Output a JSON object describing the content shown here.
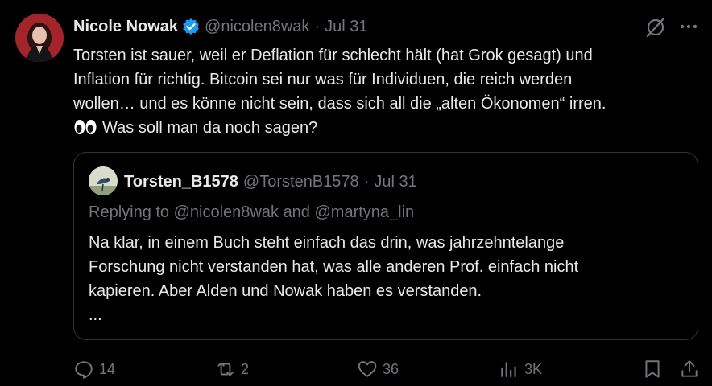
{
  "tweet": {
    "author_name": "Nicole Nowak",
    "handle": "@nicolen8wak",
    "separator": "·",
    "date": "Jul 31",
    "lines": [
      "Torsten ist sauer, weil er Deflation für schlecht hält (hat Grok gesagt) und",
      "Inflation für richtig. Bitcoin sei nur was für Individuen, die reich werden",
      "wollen… und es könne nicht sein, dass sich all die „alten Ökonomen“ irren.",
      "Was soll man da noch sagen?"
    ]
  },
  "quote": {
    "author_name": "Torsten_B1578",
    "handle": "@TorstenB1578",
    "separator": "·",
    "date": "Jul 31",
    "replying_prefix": "Replying to",
    "mention_1": "@nicolen8wak",
    "replying_and": "and",
    "mention_2": "@martyna_lin",
    "lines": [
      "Na klar, in einem Buch steht einfach das drin, was jahrzehntelange",
      "Forschung nicht verstanden hat, was alle anderen Prof. einfach nicht",
      "kapieren. Aber Alden und Nowak haben es verstanden.",
      "..."
    ]
  },
  "actions": {
    "replies": "14",
    "reposts": "2",
    "likes": "36",
    "views": "3K"
  },
  "colors": {
    "background": "#000000",
    "text": "#e7e9ea",
    "muted": "#71767b",
    "border": "#2f3336",
    "verified": "#1d9bf0"
  },
  "icons": [
    "verified-badge-icon",
    "grok-icon",
    "more-icon",
    "eyes-emoji-icon",
    "reply-icon",
    "repost-icon",
    "like-icon",
    "views-icon",
    "bookmark-icon",
    "share-icon"
  ]
}
